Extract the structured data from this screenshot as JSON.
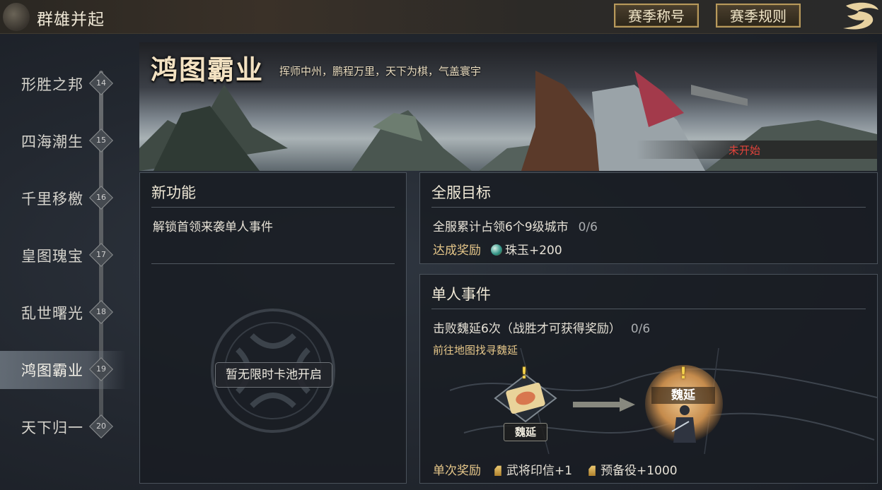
{
  "header": {
    "title": "群雄并起",
    "buttons": {
      "season_title": "赛季称号",
      "season_rules": "赛季规则"
    }
  },
  "timeline": [
    {
      "label": "形胜之邦",
      "num": "14"
    },
    {
      "label": "四海潮生",
      "num": "15"
    },
    {
      "label": "千里移檄",
      "num": "16"
    },
    {
      "label": "皇图瑰宝",
      "num": "17"
    },
    {
      "label": "乱世曙光",
      "num": "18"
    },
    {
      "label": "鸿图霸业",
      "num": "19",
      "active": true
    },
    {
      "label": "天下归一",
      "num": "20"
    }
  ],
  "banner": {
    "title": "鸿图霸业",
    "subtitle": "挥师中州，鹏程万里，天下为棋，气盖寰宇",
    "status": "未开始"
  },
  "new_feature": {
    "header": "新功能",
    "item": "解锁首领来袭单人事件",
    "pool_button": "暂无限时卡池开启"
  },
  "server_goal": {
    "header": "全服目标",
    "goal": "全服累计占领6个9级城市",
    "progress": "0/6",
    "reward_label": "达成奖励",
    "reward_item": "珠玉+200",
    "reward_icon": "pearl-icon"
  },
  "solo_event": {
    "header": "单人事件",
    "goal": "击败魏延6次（战胜才可获得奖励）",
    "progress": "0/6",
    "hint": "前往地图找寻魏延",
    "scroll_label": "魏延",
    "hero_name": "魏延",
    "reward_label": "单次奖励",
    "rewards": [
      "武将印信+1",
      "预备役+1000"
    ]
  },
  "colors": {
    "accent_gold": "#e6c78a",
    "status_red": "#e2433b",
    "button_border": "#b89a5c"
  }
}
